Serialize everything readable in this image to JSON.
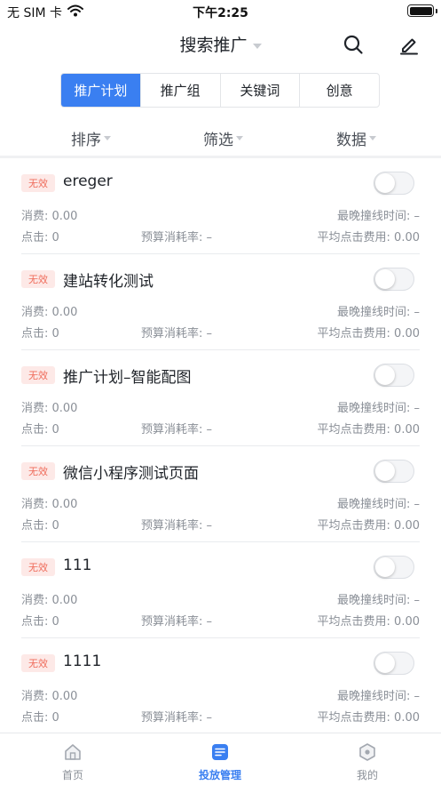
{
  "status_bar": {
    "carrier": "无 SIM 卡",
    "time": "下午2:25"
  },
  "nav": {
    "title": "搜索推广",
    "icons": [
      "search-icon",
      "edit-icon"
    ]
  },
  "tabs": [
    {
      "label": "推广计划",
      "active": true
    },
    {
      "label": "推广组",
      "active": false
    },
    {
      "label": "关键词",
      "active": false
    },
    {
      "label": "创意",
      "active": false
    }
  ],
  "filters": [
    {
      "label": "排序"
    },
    {
      "label": "筛选"
    },
    {
      "label": "数据"
    }
  ],
  "plans": [
    {
      "badge": "无效",
      "name": "ereger",
      "enabled": false,
      "spend": "消费: 0.00",
      "last_time": "最晚撞线时间: –",
      "clicks": "点击: 0",
      "budget_rate": "预算消耗率: –",
      "avg_cpc": "平均点击费用: 0.00"
    },
    {
      "badge": "无效",
      "name": "建站转化测试",
      "enabled": false,
      "spend": "消费: 0.00",
      "last_time": "最晚撞线时间: –",
      "clicks": "点击: 0",
      "budget_rate": "预算消耗率: –",
      "avg_cpc": "平均点击费用: 0.00"
    },
    {
      "badge": "无效",
      "name": "推广计划–智能配图",
      "enabled": false,
      "spend": "消费: 0.00",
      "last_time": "最晚撞线时间: –",
      "clicks": "点击: 0",
      "budget_rate": "预算消耗率: –",
      "avg_cpc": "平均点击费用: 0.00"
    },
    {
      "badge": "无效",
      "name": "微信小程序测试页面",
      "enabled": false,
      "spend": "消费: 0.00",
      "last_time": "最晚撞线时间: –",
      "clicks": "点击: 0",
      "budget_rate": "预算消耗率: –",
      "avg_cpc": "平均点击费用: 0.00"
    },
    {
      "badge": "无效",
      "name": "111",
      "enabled": false,
      "spend": "消费: 0.00",
      "last_time": "最晚撞线时间: –",
      "clicks": "点击: 0",
      "budget_rate": "预算消耗率: –",
      "avg_cpc": "平均点击费用: 0.00"
    },
    {
      "badge": "无效",
      "name": "1111",
      "enabled": false,
      "spend": "消费: 0.00",
      "last_time": "最晚撞线时间: –",
      "clicks": "点击: 0",
      "budget_rate": "预算消耗率: –",
      "avg_cpc": "平均点击费用: 0.00"
    }
  ],
  "tabbar": [
    {
      "label": "首页",
      "icon": "home-icon",
      "active": false
    },
    {
      "label": "投放管理",
      "icon": "list-icon",
      "active": true
    },
    {
      "label": "我的",
      "icon": "profile-icon",
      "active": false
    }
  ],
  "colors": {
    "accent": "#3a7ff1",
    "badge_bg": "#fde9e7",
    "badge_text": "#ef6b5a",
    "muted_text": "#8a8f97"
  }
}
